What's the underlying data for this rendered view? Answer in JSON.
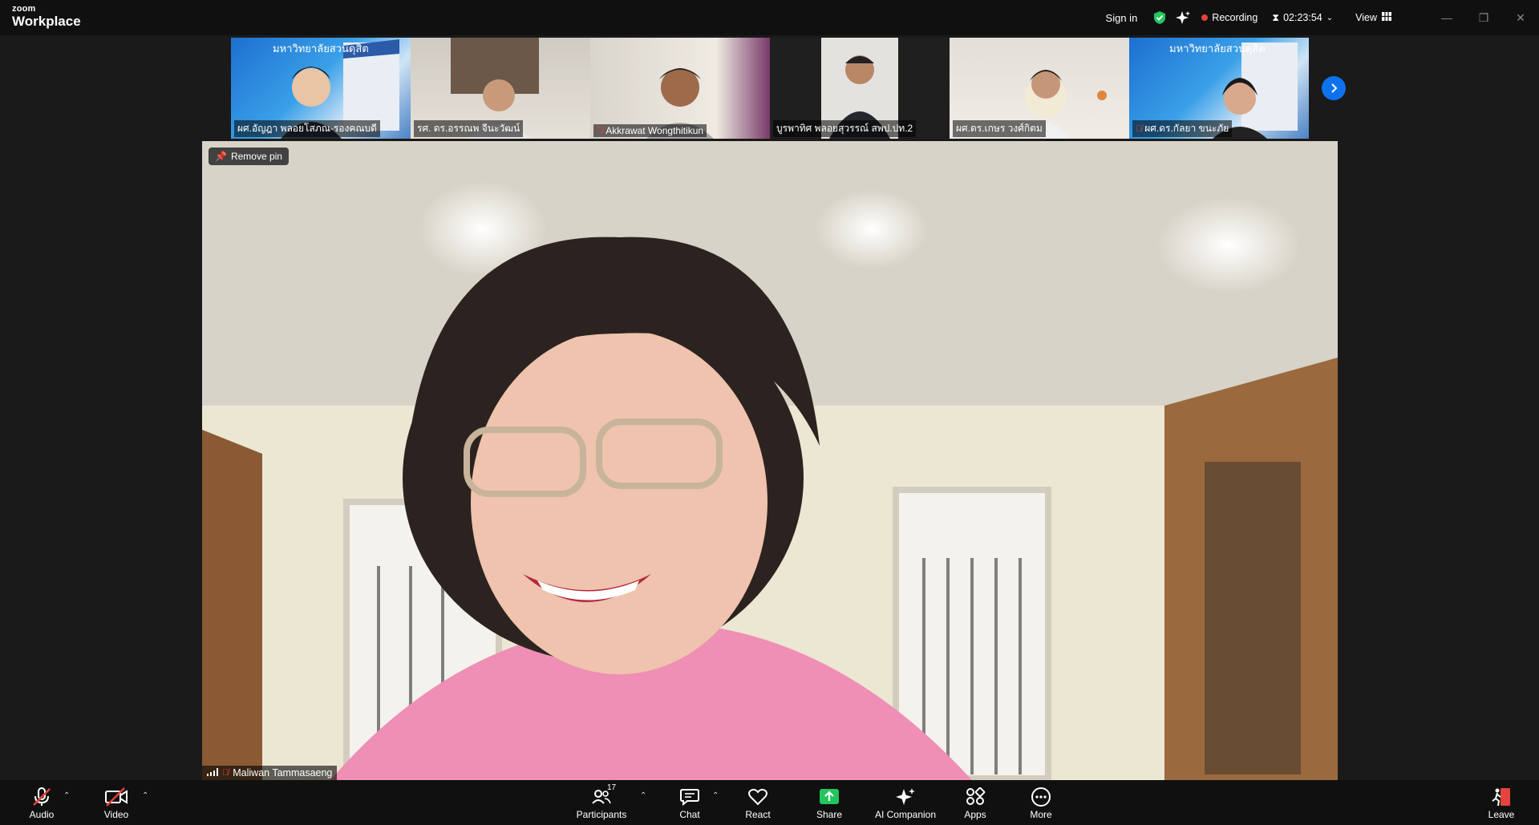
{
  "app": {
    "brand_small": "zoom",
    "brand_name": "Workplace"
  },
  "titlebar": {
    "sign_in": "Sign in",
    "recording": "Recording",
    "timer": "02:23:54",
    "view": "View"
  },
  "gallery": {
    "tiles": [
      {
        "name": "ผศ.อัญฎา พลอยโสภณ-รองคณบดี",
        "muted": false
      },
      {
        "name": "รศ. ดร.อรรณพ จีนะวัฒน์",
        "muted": false
      },
      {
        "name": "Akkrawat Wongthitikun",
        "muted": true
      },
      {
        "name": "บูรพาทิศ พลอยสุวรรณ์ สพป.ปท.2",
        "muted": false
      },
      {
        "name": "ผศ.ดร.เกษร วงศ์กิตม",
        "muted": false
      },
      {
        "name": "ผศ.ดร.กัลยา ขนะภัย",
        "muted": true
      }
    ]
  },
  "main": {
    "remove_pin": "Remove pin",
    "speaker_name": "Maliwan Tammasaeng"
  },
  "toolbar": {
    "audio": "Audio",
    "video": "Video",
    "participants": "Participants",
    "participants_count": "17",
    "chat": "Chat",
    "react": "React",
    "share": "Share",
    "ai_companion": "AI Companion",
    "apps": "Apps",
    "more": "More",
    "leave": "Leave"
  },
  "colors": {
    "accent": "#0e72ed",
    "recording": "#e5433b",
    "share": "#22c55e",
    "leave": "#e5433b"
  }
}
